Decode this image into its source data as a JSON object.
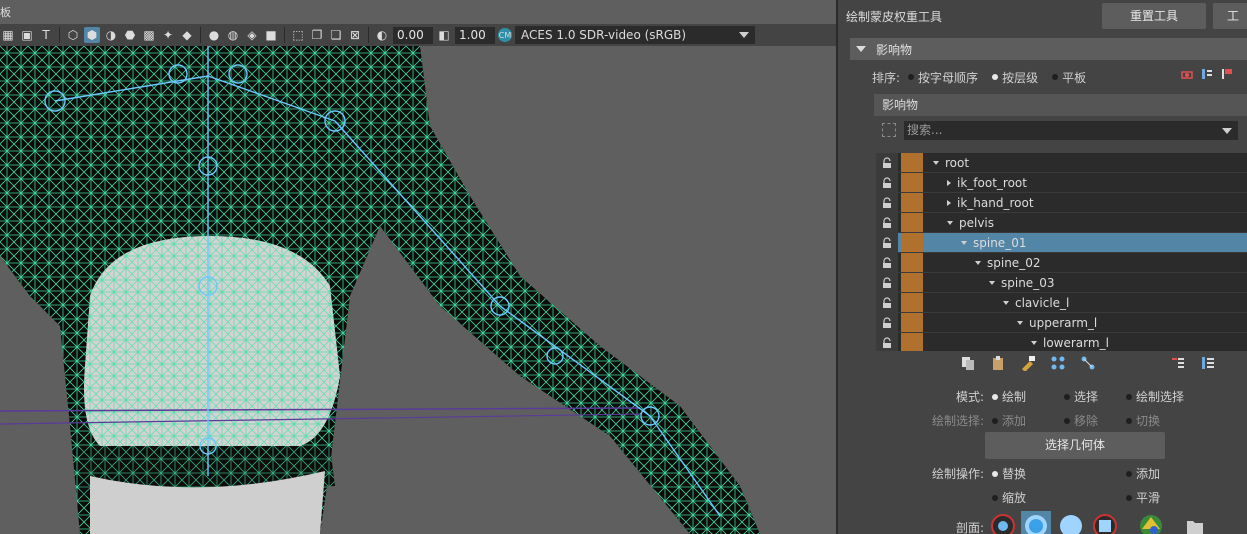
{
  "viewport": {
    "corner_text": "板",
    "toolbar": {
      "exposure_value": "0.00",
      "gamma_value": "1.00",
      "color_space": "ACES 1.0 SDR-video (sRGB)"
    }
  },
  "panel": {
    "title": "绘制蒙皮权重工具",
    "reset_button": "重置工具",
    "truncated_button": "工",
    "section_title": "影响物",
    "sort": {
      "label": "排序:",
      "options": [
        "按字母顺序",
        "按层级",
        "平板"
      ],
      "selected": "按层级"
    },
    "influences_header": "影响物",
    "search_placeholder": "搜索...",
    "tree": [
      {
        "name": "root",
        "depth": 0,
        "expander": "open",
        "selected": false
      },
      {
        "name": "ik_foot_root",
        "depth": 1,
        "expander": "closed",
        "selected": false
      },
      {
        "name": "ik_hand_root",
        "depth": 1,
        "expander": "closed",
        "selected": false
      },
      {
        "name": "pelvis",
        "depth": 1,
        "expander": "open",
        "selected": false
      },
      {
        "name": "spine_01",
        "depth": 2,
        "expander": "open",
        "selected": true
      },
      {
        "name": "spine_02",
        "depth": 3,
        "expander": "open",
        "selected": false
      },
      {
        "name": "spine_03",
        "depth": 4,
        "expander": "open",
        "selected": false
      },
      {
        "name": "clavicle_l",
        "depth": 5,
        "expander": "open",
        "selected": false
      },
      {
        "name": "upperarm_l",
        "depth": 6,
        "expander": "open",
        "selected": false
      },
      {
        "name": "lowerarm_l",
        "depth": 7,
        "expander": "open",
        "selected": false
      }
    ],
    "influence_color": "#b0712f",
    "selection_color": "#5285a6",
    "mode": {
      "label": "模式:",
      "options": [
        "绘制",
        "选择",
        "绘制选择"
      ],
      "selected": "绘制"
    },
    "paint_select": {
      "label": "绘制选择:",
      "options": [
        "添加",
        "移除",
        "切换"
      ],
      "enabled": false
    },
    "select_geometry_button": "选择几何体",
    "paint_operation": {
      "label": "绘制操作:",
      "options": [
        "替换",
        "添加",
        "缩放",
        "平滑"
      ],
      "selected": "替换"
    },
    "profile": {
      "label": "剖面:"
    }
  }
}
